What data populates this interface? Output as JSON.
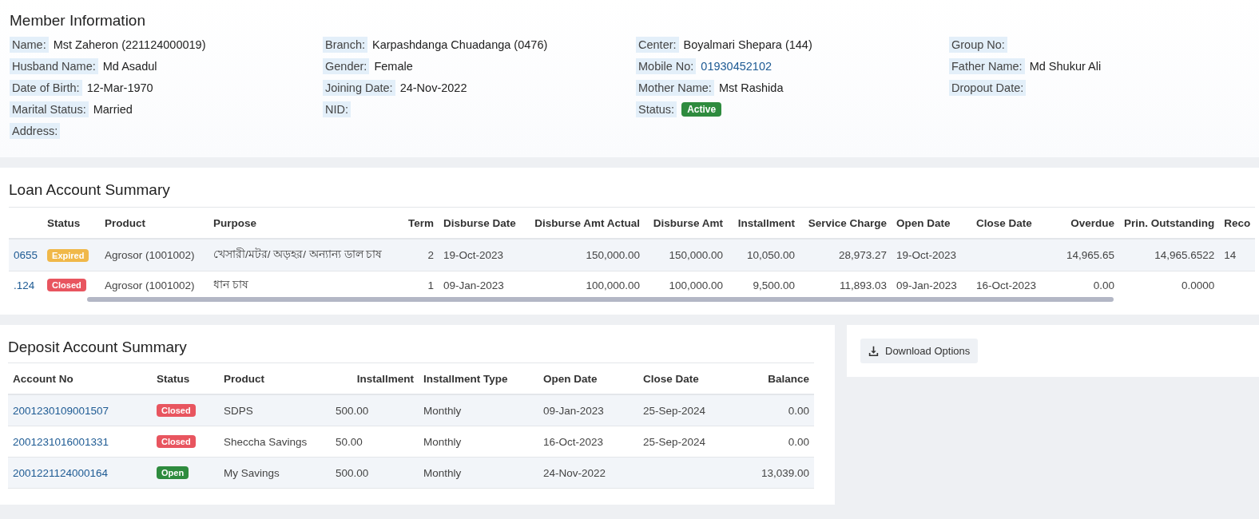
{
  "member": {
    "title": "Member Information",
    "columns": [
      [
        {
          "label": "Name:",
          "value": "Mst Zaheron (221124000019)",
          "kind": "text"
        },
        {
          "label": "Husband Name:",
          "value": "Md Asadul",
          "kind": "text"
        },
        {
          "label": "Date of Birth:",
          "value": "12-Mar-1970",
          "kind": "text"
        },
        {
          "label": "Marital Status:",
          "value": "Married",
          "kind": "text"
        },
        {
          "label": "Address:",
          "kind": "text"
        }
      ],
      [
        {
          "label": "Branch:",
          "value": "Karpashdanga Chuadanga (0476)",
          "kind": "text"
        },
        {
          "label": "Gender:",
          "value": "Female",
          "kind": "text"
        },
        {
          "label": "Joining Date:",
          "value": "24-Nov-2022",
          "kind": "text"
        },
        {
          "label": "NID:",
          "kind": "text"
        }
      ],
      [
        {
          "label": "Center:",
          "value": "Boyalmari Shepara (144)",
          "kind": "text"
        },
        {
          "label": "Mobile No:",
          "value": "01930452102",
          "kind": "link"
        },
        {
          "label": "Mother Name:",
          "value": "Mst Rashida",
          "kind": "text"
        },
        {
          "label": "Status:",
          "value": "Active",
          "kind": "badge",
          "color": "#2e8b3e"
        }
      ],
      [
        {
          "label": "Group No:",
          "kind": "text"
        },
        {
          "label": "Father Name:",
          "value": "Md Shukur Ali",
          "kind": "text"
        },
        {
          "label": "Dropout Date:",
          "kind": "text"
        }
      ]
    ]
  },
  "loans": {
    "title": "Loan Account Summary",
    "columns": [
      {},
      {
        "label": "Status"
      },
      {
        "label": "Product"
      },
      {
        "label": "Purpose"
      },
      {
        "label": "Term"
      },
      {
        "label": "Disburse Date"
      },
      {
        "label": "Disburse Amt Actual"
      },
      {
        "label": "Disburse Amt"
      },
      {
        "label": "Installment"
      },
      {
        "label": "Service Charge"
      },
      {
        "label": "Open Date"
      },
      {
        "label": "Close Date"
      },
      {
        "label": "Overdue"
      },
      {
        "label": "Prin. Outstanding"
      },
      {
        "label": "Reco"
      }
    ],
    "rows": [
      {
        "color": "#f0b849",
        "cells": [
          "0655",
          "Expired",
          "Agrosor (1001002)",
          "খেসারী/মটর/ অড়হর/ অন্যান্য ডাল চাষ",
          "2",
          "19-Oct-2023",
          "150,000.00",
          "150,000.00",
          "10,050.00",
          "28,973.27",
          "19-Oct-2023",
          "",
          "14,965.65",
          "14,965.6522",
          "14"
        ]
      },
      {
        "color": "#e8555f",
        "cells": [
          ".124",
          "Closed",
          "Agrosor (1001002)",
          "ধান চাষ",
          "1",
          "09-Jan-2023",
          "100,000.00",
          "100,000.00",
          "9,500.00",
          "11,893.03",
          "09-Jan-2023",
          "16-Oct-2023",
          "0.00",
          "0.0000",
          ""
        ]
      }
    ]
  },
  "deposits": {
    "title": "Deposit Account Summary",
    "columns": [
      "Account No",
      "Status",
      "Product",
      "Installment",
      "Installment Type",
      "Open Date",
      "Close Date",
      "Balance"
    ],
    "rows": [
      {
        "color": "#e8555f",
        "cells": [
          "2001230109001507",
          "Closed",
          "SDPS",
          "500.00",
          "Monthly",
          "09-Jan-2023",
          "25-Sep-2024",
          "0.00"
        ]
      },
      {
        "color": "#e8555f",
        "cells": [
          "2001231016001331",
          "Closed",
          "Sheccha Savings",
          "50.00",
          "Monthly",
          "16-Oct-2023",
          "25-Sep-2024",
          "0.00"
        ]
      },
      {
        "color": "#2e8b3e",
        "cells": [
          "2001221124000164",
          "Open",
          "My Savings",
          "500.00",
          "Monthly",
          "24-Nov-2022",
          "",
          "13,039.00"
        ]
      }
    ]
  },
  "download": {
    "label": "Download Options"
  }
}
